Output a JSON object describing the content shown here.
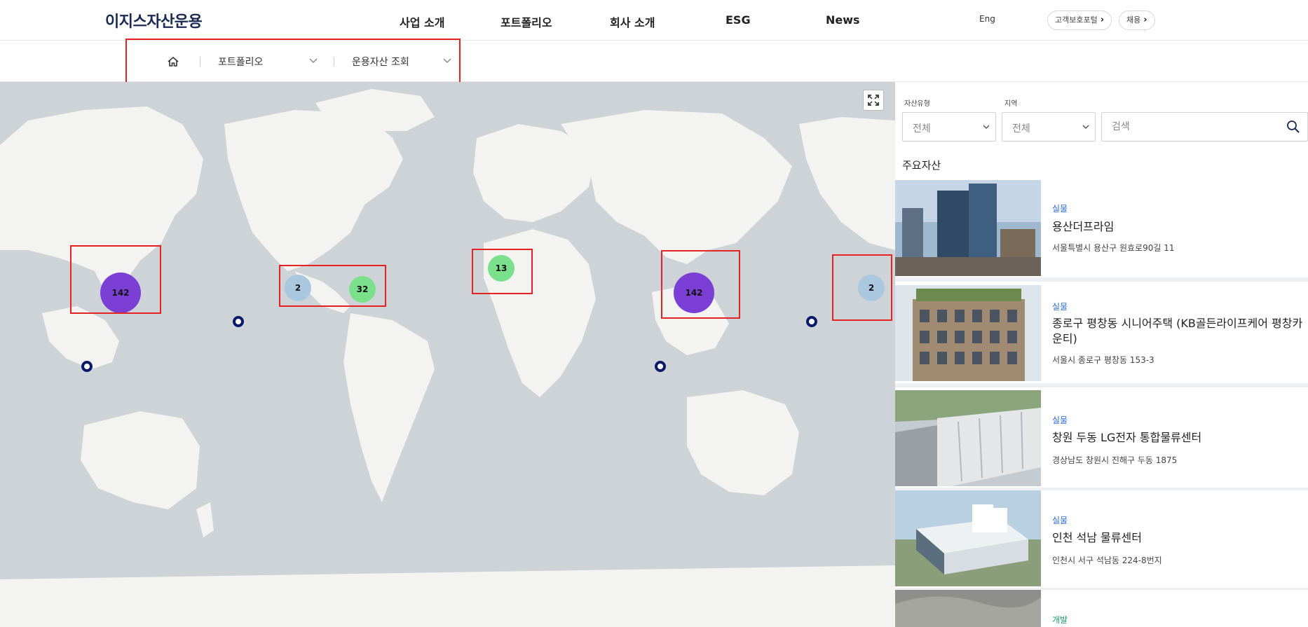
{
  "header": {
    "logo": "이지스자산운용",
    "nav": [
      "사업 소개",
      "포트폴리오",
      "회사 소개",
      "ESG",
      "News"
    ],
    "util": [
      "고객보호포털",
      "채용"
    ],
    "lang": "Eng"
  },
  "breadcrumb": {
    "items": [
      "포트폴리오",
      "운용자산 조회"
    ]
  },
  "map": {
    "clusters": [
      "142",
      "2",
      "32",
      "13",
      "142",
      "2"
    ],
    "colors": {
      "ocean": "#cdd3d6",
      "land": "#f3f3f2",
      "purple": "#7c3fd6",
      "blue": "#a9c8e0",
      "green": "#7ae08c",
      "pin": "#0b1a6b"
    }
  },
  "filters": {
    "asset_type_label": "자산유형",
    "asset_type_value": "전체",
    "region_label": "지역",
    "region_value": "전체",
    "search_placeholder": "검색"
  },
  "featured": {
    "title": "주요자산",
    "items": [
      {
        "category": "실물",
        "name": "용산더프라임",
        "address": "서울특별시 용산구 원효로90길 11"
      },
      {
        "category": "실물",
        "name": "종로구 평창동 시니어주택 (KB골든라이프케어 평창카운티)",
        "address": "서울시 종로구 평창동 153-3"
      },
      {
        "category": "실물",
        "name": "창원 두동 LG전자 통합물류센터",
        "address": "경상남도 창원시 진해구 두동 1875"
      },
      {
        "category": "실물",
        "name": "인천 석남 물류센터",
        "address": "인천시 서구 석남동 224-8번지"
      },
      {
        "category": "개발",
        "name": "",
        "address": ""
      }
    ]
  }
}
